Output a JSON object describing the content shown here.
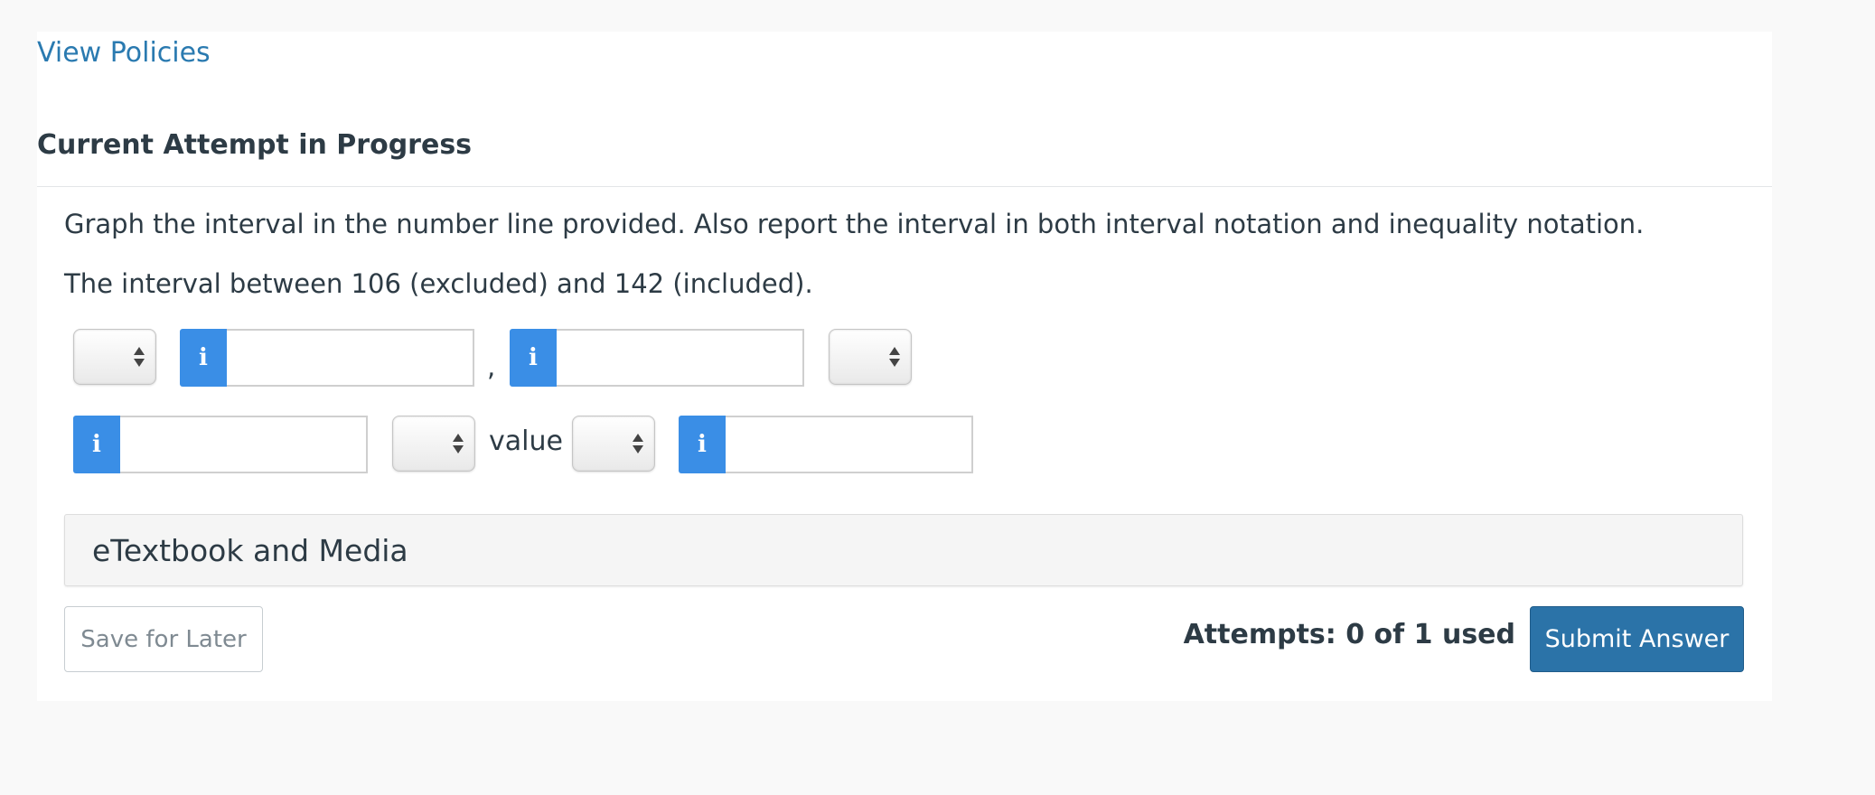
{
  "links": {
    "view_policies": "View Policies"
  },
  "attempt": {
    "title": "Current Attempt in Progress"
  },
  "question": {
    "instruction": "Graph the interval in the number line provided. Also report the interval in both interval notation and inequality notation.",
    "prompt": "The interval between 106 (excluded) and 142 (included)."
  },
  "interval_notation": {
    "left_bracket_select": "",
    "lower_bound": "",
    "separator": ",",
    "upper_bound": "",
    "right_bracket_select": ""
  },
  "inequality_notation": {
    "lower_value": "",
    "first_operator_select": "",
    "variable_label": "value",
    "second_operator_select": "",
    "upper_value": ""
  },
  "info_icon_glyph": "i",
  "resources": {
    "etextbook_label": "eTextbook and Media"
  },
  "footer": {
    "save_label": "Save for Later",
    "attempts_text": "Attempts: 0 of 1 used",
    "submit_label": "Submit Answer"
  },
  "colors": {
    "link": "#2a7ab0",
    "info_badge": "#3a8ee6",
    "submit_button": "#2b73a8",
    "text": "#2d3b45"
  }
}
